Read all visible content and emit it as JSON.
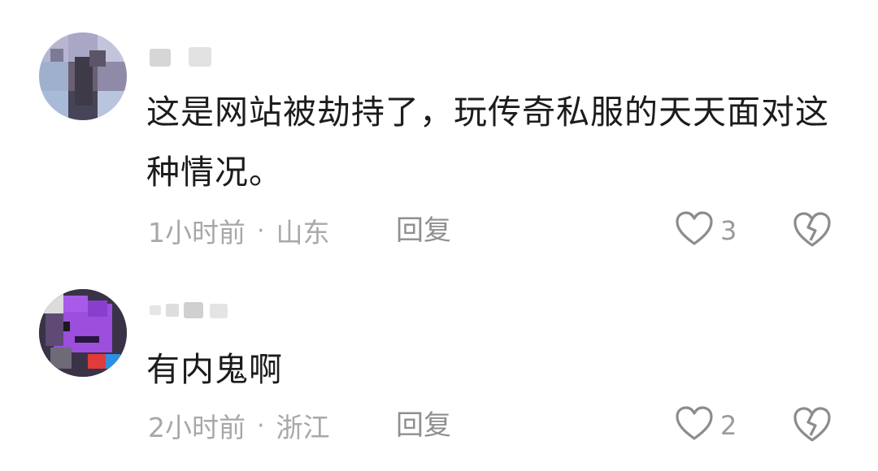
{
  "comments": [
    {
      "username": "",
      "text": "这是网站被劫持了，玩传奇私服的天天面对这种情况。",
      "time": "1小时前",
      "separator": "·",
      "location": "山东",
      "reply_label": "回复",
      "like_count": "3"
    },
    {
      "username": "",
      "text": "有内鬼啊",
      "time": "2小时前",
      "separator": "·",
      "location": "浙江",
      "reply_label": "回复",
      "like_count": "2"
    }
  ],
  "icons": {
    "like": "heart-outline-icon",
    "dislike": "broken-heart-icon"
  },
  "colors": {
    "text": "#1c1c1c",
    "meta": "#a8a8a8",
    "icon": "#8c8c8c"
  }
}
